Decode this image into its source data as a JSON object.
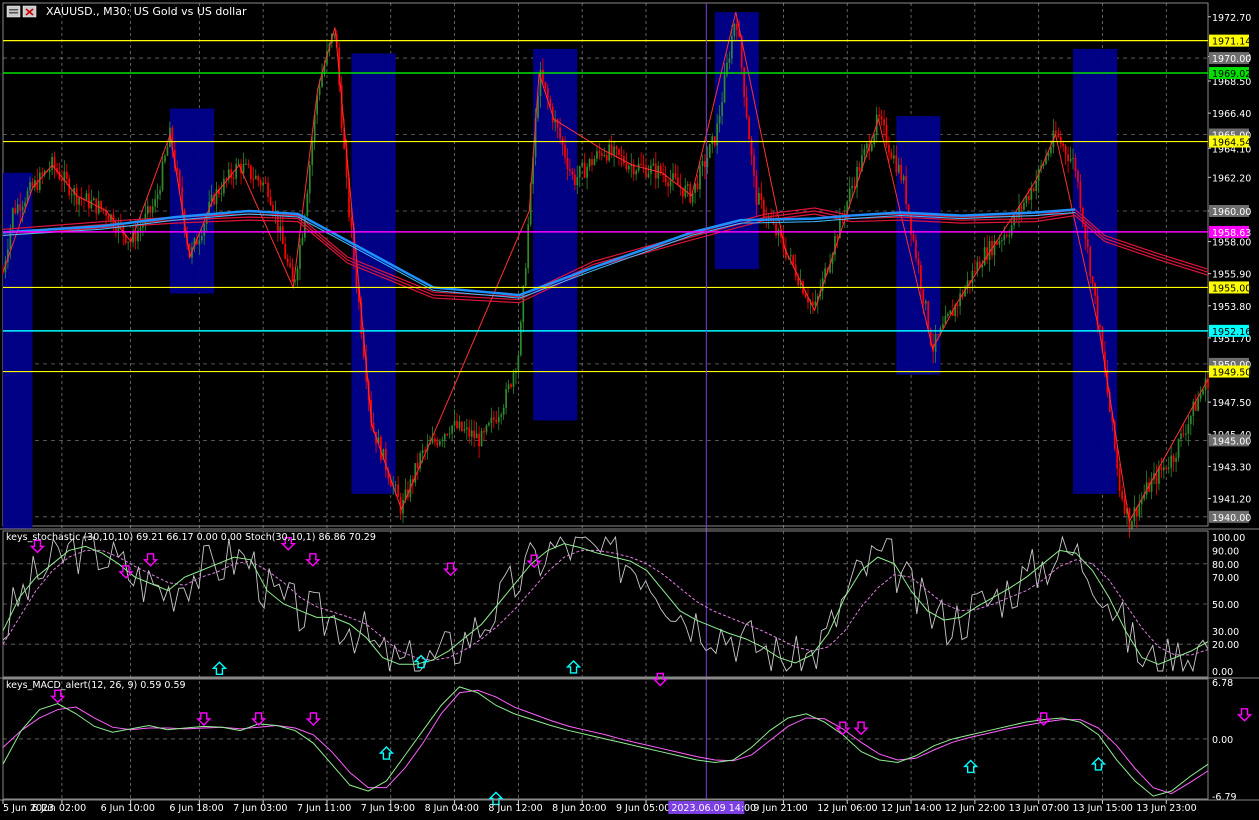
{
  "window": {
    "symbol_title": "XAUUSD., M30:  US Gold vs US dollar"
  },
  "colors": {
    "background": "#000000",
    "grid": "#c8c8c8",
    "bull": "#2e8b2e",
    "bear": "#ff0000",
    "ma_red": "#dc143c",
    "ma_blue": "#1e90ff",
    "box": "#00008b",
    "zigzag": "#ff3030",
    "level_yellow": "#ffff00",
    "level_green": "#00e000",
    "level_cyan": "#00ffff",
    "level_magenta": "#ff00ff",
    "stoch_main": "#c8c8c8",
    "stoch_signal": "#e080e0",
    "stoch_k": "#90ee90",
    "macd_main": "#90ee90",
    "macd_signal": "#ff60ff",
    "arrow_down": "#ff00ff",
    "arrow_up": "#00ffff",
    "vline": "#7b3fe4"
  },
  "chart_data": [
    {
      "type": "candlestick",
      "panel": "price",
      "ylim": [
        1939.4,
        1973.6
      ],
      "y_ticks": [
        "1972.70",
        "1970.10",
        "1968.50",
        "1966.40",
        "1964.10",
        "1962.20",
        "1960.00",
        "1958.00",
        "1955.90",
        "1953.80",
        "1951.70",
        "1949.50",
        "1947.50",
        "1945.40",
        "1943.30",
        "1941.20",
        "1939.10"
      ],
      "grid_levels": [
        "1970.00",
        "1965.00",
        "1960.00",
        "1955.00",
        "1950.00",
        "1945.00",
        "1940.00"
      ],
      "level_lines": [
        {
          "value": 1971.14,
          "label": "1971.14",
          "color": "#ffff00",
          "text_color": "#000000"
        },
        {
          "value": 1969.02,
          "label": "1969.02",
          "color": "#00e000",
          "text_color": "#000000"
        },
        {
          "value": 1964.54,
          "label": "1964.54",
          "color": "#ffff00",
          "text_color": "#000000"
        },
        {
          "value": 1958.63,
          "label": "1958.63",
          "color": "#ff00ff",
          "text_color": "#ffffff"
        },
        {
          "value": 1955.0,
          "label": "1955.00",
          "color": "#ffff00",
          "text_color": "#000000"
        },
        {
          "value": 1952.16,
          "label": "1952.16",
          "color": "#00ffff",
          "text_color": "#000000"
        },
        {
          "value": 1949.5,
          "label": "1949.50",
          "color": "#ffff00",
          "text_color": "#000000"
        }
      ],
      "grid_badges": [
        "1970.00",
        "1965.00",
        "1960.00",
        "1955.00",
        "1950.00",
        "1945.00",
        "1940.00"
      ],
      "series_path": [
        [
          0,
          1956
        ],
        [
          4,
          1960
        ],
        [
          12,
          1961.5
        ],
        [
          20,
          1963
        ],
        [
          30,
          1961
        ],
        [
          42,
          1960
        ],
        [
          52,
          1958
        ],
        [
          62,
          1960.5
        ],
        [
          68,
          1965
        ],
        [
          76,
          1957
        ],
        [
          86,
          1961
        ],
        [
          96,
          1963
        ],
        [
          108,
          1961.5
        ],
        [
          118,
          1955
        ],
        [
          122,
          1959
        ],
        [
          128,
          1968
        ],
        [
          135,
          1972
        ],
        [
          140,
          1961
        ],
        [
          150,
          1946
        ],
        [
          162,
          1940.5
        ],
        [
          170,
          1944
        ],
        [
          182,
          1946
        ],
        [
          195,
          1945
        ],
        [
          205,
          1948
        ],
        [
          210,
          1951
        ],
        [
          214,
          1960
        ],
        [
          218,
          1969
        ],
        [
          224,
          1966
        ],
        [
          232,
          1962
        ],
        [
          244,
          1964
        ],
        [
          256,
          1963
        ],
        [
          268,
          1962.5
        ],
        [
          280,
          1961
        ],
        [
          290,
          1965
        ],
        [
          298,
          1973
        ],
        [
          306,
          1961
        ],
        [
          318,
          1957.5
        ],
        [
          330,
          1953.5
        ],
        [
          338,
          1958
        ],
        [
          346,
          1962
        ],
        [
          356,
          1966
        ],
        [
          366,
          1962
        ],
        [
          378,
          1951
        ],
        [
          388,
          1954
        ],
        [
          398,
          1957
        ],
        [
          410,
          1959
        ],
        [
          420,
          1962
        ],
        [
          428,
          1965
        ],
        [
          436,
          1963
        ],
        [
          446,
          1952
        ],
        [
          454,
          1942
        ],
        [
          458,
          1939.7
        ],
        [
          466,
          1942
        ],
        [
          476,
          1944
        ],
        [
          484,
          1947
        ],
        [
          490,
          1949
        ]
      ],
      "ma_red": [
        [
          0,
          1958.6
        ],
        [
          40,
          1959.1
        ],
        [
          70,
          1959.4
        ],
        [
          100,
          1959.6
        ],
        [
          120,
          1959.5
        ],
        [
          140,
          1956.8
        ],
        [
          175,
          1954.5
        ],
        [
          210,
          1954.2
        ],
        [
          240,
          1956.5
        ],
        [
          280,
          1958.3
        ],
        [
          310,
          1959.6
        ],
        [
          330,
          1960
        ],
        [
          345,
          1959.5
        ],
        [
          365,
          1959.6
        ],
        [
          390,
          1959.4
        ],
        [
          420,
          1959.5
        ],
        [
          436,
          1959.9
        ],
        [
          448,
          1958.2
        ],
        [
          470,
          1957
        ],
        [
          490,
          1956
        ]
      ],
      "ma_blue": [
        [
          0,
          1958.6
        ],
        [
          40,
          1959.0
        ],
        [
          70,
          1959.6
        ],
        [
          100,
          1960.0
        ],
        [
          120,
          1959.8
        ],
        [
          175,
          1955
        ],
        [
          210,
          1954.5
        ],
        [
          240,
          1956.3
        ],
        [
          280,
          1958.6
        ],
        [
          300,
          1959.4
        ],
        [
          330,
          1959.5
        ],
        [
          345,
          1959.7
        ],
        [
          365,
          1959.9
        ],
        [
          390,
          1959.7
        ],
        [
          420,
          1959.9
        ],
        [
          436,
          1960.1
        ]
      ],
      "boxes": [
        {
          "from": 0,
          "to": 12,
          "high": 1962.5,
          "low": 1939.2
        },
        {
          "from": 68,
          "to": 86,
          "high": 1966.7,
          "low": 1954.6
        },
        {
          "from": 142,
          "to": 160,
          "high": 1970.3,
          "low": 1941.5
        },
        {
          "from": 216,
          "to": 234,
          "high": 1970.6,
          "low": 1946.3
        },
        {
          "from": 290,
          "to": 308,
          "high": 1973.0,
          "low": 1956.2
        },
        {
          "from": 364,
          "to": 382,
          "high": 1966.2,
          "low": 1949.3
        },
        {
          "from": 436,
          "to": 454,
          "high": 1970.6,
          "low": 1941.5
        }
      ],
      "vline_x": 286,
      "x_labels": [
        "5 Jun 2023",
        "6 Jun 02:00",
        "6 Jun 10:00",
        "6 Jun 18:00",
        "7 Jun 03:00",
        "7 Jun 11:00",
        "7 Jun 19:00",
        "8 Jun 04:00",
        "8 Jun 12:00",
        "8 Jun 20:00",
        "9 Jun 05:00",
        "9 Jun 21:00",
        "12 Jun 06:00",
        "12 Jun 14:00",
        "12 Jun 22:00",
        "13 Jun 07:00",
        "13 Jun 15:00",
        "13 Jun 23:00"
      ],
      "x_label_index": [
        0,
        24,
        52,
        80,
        106,
        132,
        158,
        184,
        210,
        236,
        262,
        318,
        344,
        370,
        396,
        422,
        448,
        474
      ],
      "time_marker": "2023.06.09 14:00",
      "n_bars": 492
    },
    {
      "type": "line",
      "panel": "stochastic",
      "title": "keys_stochastic (30,10,10) 69.21 66.17 0.00 0.00 Stoch(30,10,1) 86.86 70.29",
      "ylim": [
        0,
        100
      ],
      "y_ticks": [
        "100.00",
        "90.00",
        "80.00",
        "70.00",
        "50.00",
        "30.00",
        "20.00",
        "0.00"
      ],
      "grid_levels": [
        80,
        50,
        20
      ],
      "series": [
        {
          "name": "main",
          "values": [
            30,
            55,
            70,
            80,
            90,
            93,
            88,
            80,
            70,
            65,
            60,
            70,
            75,
            80,
            85,
            83,
            60,
            50,
            45,
            40,
            40,
            35,
            25,
            10,
            5,
            5,
            8,
            15,
            25,
            35,
            50,
            65,
            80,
            90,
            95,
            92,
            88,
            85,
            82,
            75,
            60,
            45,
            38,
            33,
            28,
            24,
            18,
            10,
            6,
            12,
            28,
            55,
            75,
            85,
            80,
            60,
            45,
            38,
            40,
            48,
            55,
            62,
            70,
            80,
            90,
            88,
            75,
            55,
            30,
            10,
            5,
            10,
            15,
            22
          ]
        },
        {
          "name": "signal",
          "values": [
            20,
            40,
            60,
            75,
            85,
            90,
            90,
            85,
            78,
            72,
            66,
            64,
            70,
            74,
            80,
            82,
            75,
            66,
            55,
            48,
            44,
            40,
            35,
            25,
            15,
            10,
            8,
            10,
            16,
            24,
            34,
            46,
            60,
            74,
            85,
            90,
            90,
            88,
            85,
            80,
            72,
            62,
            52,
            45,
            40,
            35,
            30,
            24,
            18,
            15,
            18,
            30,
            48,
            62,
            72,
            70,
            60,
            50,
            45,
            46,
            50,
            55,
            60,
            68,
            78,
            83,
            80,
            68,
            50,
            32,
            18,
            12,
            12,
            16
          ]
        }
      ],
      "arrows_down": [
        {
          "i": 14,
          "v": 90
        },
        {
          "i": 50,
          "v": 71
        },
        {
          "i": 60,
          "v": 80
        },
        {
          "i": 116,
          "v": 92
        },
        {
          "i": 126,
          "v": 80
        },
        {
          "i": 182,
          "v": 73
        },
        {
          "i": 216,
          "v": 79
        }
      ],
      "arrows_up": [
        {
          "i": 88,
          "v": 5
        },
        {
          "i": 170,
          "v": 10
        },
        {
          "i": 232,
          "v": 6
        }
      ]
    },
    {
      "type": "line",
      "panel": "macd",
      "title": "keys_MACD_alert(12, 26, 9) 0.59 0.59",
      "ylim": [
        -6.79,
        6.78
      ],
      "y_ticks": [
        "6.78",
        "0.00",
        "-6.79"
      ],
      "series": [
        {
          "name": "macd",
          "values": [
            -3,
            1,
            3.5,
            4.2,
            3,
            1.5,
            0.8,
            1.2,
            1.6,
            1.1,
            1.3,
            1.5,
            1.4,
            1,
            1.8,
            1.6,
            1,
            -0.5,
            -3,
            -5.5,
            -6.2,
            -5,
            -2,
            1,
            4,
            6.2,
            5.5,
            4,
            3,
            2.3,
            1.6,
            1,
            0.5,
            0,
            -0.5,
            -1,
            -1.5,
            -2,
            -2.5,
            -2.8,
            -2.5,
            -1,
            1,
            2.5,
            3,
            2,
            0.5,
            -1.5,
            -2.5,
            -2.8,
            -2,
            -0.8,
            0,
            0.5,
            1,
            1.5,
            2,
            2.3,
            2.5,
            2,
            0.5,
            -2.5,
            -5,
            -6.8,
            -6.2,
            -4.5,
            -3
          ]
        },
        {
          "name": "signal",
          "values": [
            -1,
            1,
            2.5,
            3.5,
            3.8,
            2.5,
            1.4,
            1.1,
            1.3,
            1.3,
            1.2,
            1.3,
            1.4,
            1.2,
            1.4,
            1.6,
            1.3,
            0.5,
            -1.5,
            -4,
            -5.8,
            -5.8,
            -3.5,
            -0.5,
            3,
            5.5,
            5.8,
            5,
            3.8,
            3,
            2.2,
            1.5,
            1,
            0.5,
            -0.1,
            -0.6,
            -1.1,
            -1.6,
            -2.1,
            -2.5,
            -2.6,
            -1.9,
            -0.2,
            1.5,
            2.5,
            2.4,
            1.2,
            -0.4,
            -1.8,
            -2.5,
            -2.3,
            -1.3,
            -0.4,
            0.2,
            0.7,
            1.2,
            1.6,
            2,
            2.3,
            2.3,
            1.3,
            -0.8,
            -3.5,
            -5.8,
            -6.5,
            -5.2,
            -3.8
          ]
        }
      ],
      "arrows_down": [
        {
          "i": 3,
          "v": 4.6
        },
        {
          "i": 11,
          "v": 1.9
        },
        {
          "i": 14,
          "v": 1.9
        },
        {
          "i": 17,
          "v": 1.9
        },
        {
          "i": 36,
          "v": 6.6
        },
        {
          "i": 46,
          "v": 0.8
        },
        {
          "i": 47,
          "v": 0.8
        },
        {
          "i": 57,
          "v": 1.9
        },
        {
          "i": 68,
          "v": 2.4
        }
      ],
      "arrows_up": [
        {
          "i": 21,
          "v": -1.2
        },
        {
          "i": 27,
          "v": -6.6
        },
        {
          "i": 53,
          "v": -2.8
        },
        {
          "i": 60,
          "v": -2.5
        },
        {
          "i": 73,
          "v": -6.6
        }
      ]
    }
  ]
}
